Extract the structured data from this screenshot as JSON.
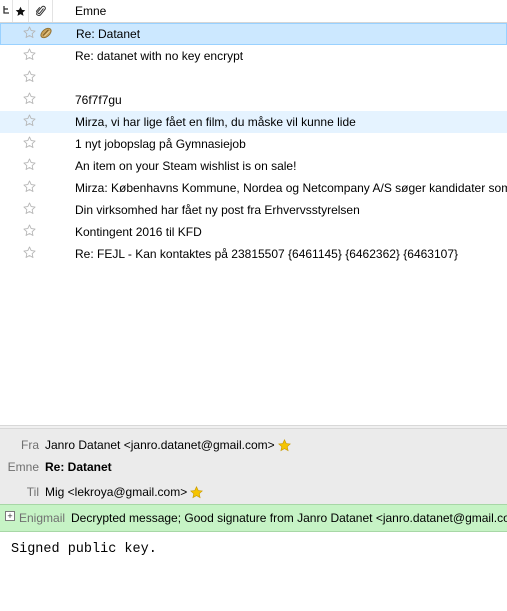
{
  "list": {
    "columns": {
      "thread_icon": "thread-icon",
      "star_icon": "star-column-icon",
      "attachment_icon": "paperclip-icon",
      "subject_label": "Emne"
    },
    "rows": [
      {
        "subject": "Re: Datanet",
        "starred": false,
        "attachment": true,
        "state": "selected"
      },
      {
        "subject": "Re: datanet with no key encrypt",
        "starred": false,
        "attachment": false,
        "state": "normal"
      },
      {
        "subject": "",
        "starred": false,
        "attachment": false,
        "state": "normal"
      },
      {
        "subject": "76f7f7gu",
        "starred": false,
        "attachment": false,
        "state": "normal"
      },
      {
        "subject": "Mirza, vi har lige fået en film, du måske vil kunne lide",
        "starred": false,
        "attachment": false,
        "state": "hovered"
      },
      {
        "subject": "1 nyt jobopslag på Gymnasiejob",
        "starred": false,
        "attachment": false,
        "state": "normal"
      },
      {
        "subject": "An item on your Steam wishlist is on sale!",
        "starred": false,
        "attachment": false,
        "state": "normal"
      },
      {
        "subject": "Mirza: Københavns Kommune, Nordea og Netcompany A/S søger kandidater som",
        "starred": false,
        "attachment": false,
        "state": "normal"
      },
      {
        "subject": "Din virksomhed har fået ny post fra Erhvervsstyrelsen",
        "starred": false,
        "attachment": false,
        "state": "normal"
      },
      {
        "subject": "Kontingent 2016 til KFD",
        "starred": false,
        "attachment": false,
        "state": "normal"
      },
      {
        "subject": "Re: FEJL - Kan kontaktes på 23815507 {6461145} {6462362} {6463107}",
        "starred": false,
        "attachment": false,
        "state": "normal"
      }
    ]
  },
  "message": {
    "from_label": "Fra",
    "from_value": "Janro Datanet <janro.datanet@gmail.com>",
    "subject_label": "Emne",
    "subject_value": "Re: Datanet",
    "to_label": "Til",
    "to_value": "Mig <lekroya@gmail.com>",
    "contact_star_color": "#f5c400"
  },
  "enigmail": {
    "toggle": "+",
    "label": "Enigmail",
    "status": "Decrypted message; Good signature from Janro Datanet <janro.datanet@gmail.com>",
    "bar_color": "#c6f3c5"
  },
  "body": {
    "text": "Signed public key."
  },
  "colors": {
    "selected_row": "#cce8ff",
    "hovered_row": "#e5f3ff",
    "header_bg": "#ebebeb"
  }
}
